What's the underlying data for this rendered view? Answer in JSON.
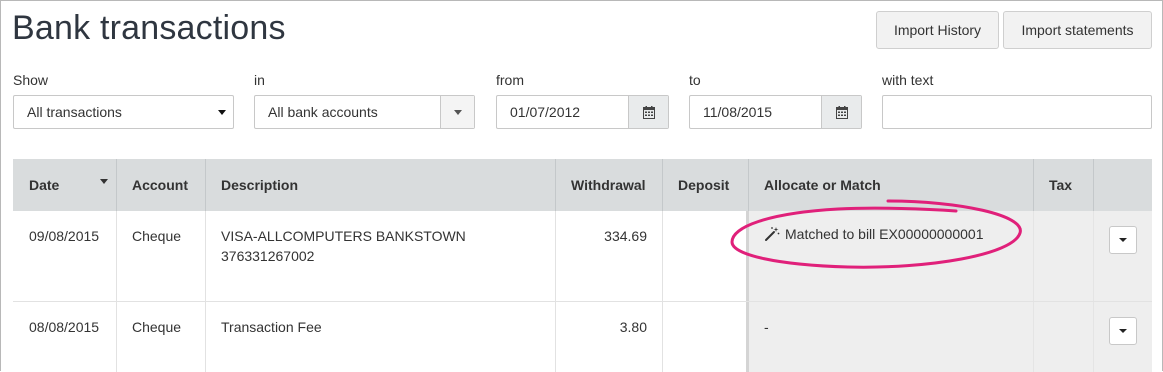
{
  "header": {
    "title": "Bank transactions",
    "import_history": "Import History",
    "import_statements": "Import statements"
  },
  "filters": {
    "show_label": "Show",
    "show_value": "All transactions",
    "in_label": "in",
    "in_value": "All bank accounts",
    "from_label": "from",
    "from_value": "01/07/2012",
    "to_label": "to",
    "to_value": "11/08/2015",
    "text_label": "with text",
    "text_value": ""
  },
  "table": {
    "columns": [
      "Date",
      "Account",
      "Description",
      "Withdrawal",
      "Deposit",
      "Allocate or Match",
      "Tax"
    ],
    "rows": [
      {
        "date": "09/08/2015",
        "account": "Cheque",
        "description_line1": "VISA-ALLCOMPUTERS BANKSTOWN",
        "description_line2": "376331267002",
        "withdrawal": "334.69",
        "deposit": "",
        "allocate": "Matched to bill EX00000000001",
        "tax": ""
      },
      {
        "date": "08/08/2015",
        "account": "Cheque",
        "description_line1": "Transaction Fee",
        "description_line2": "",
        "withdrawal": "3.80",
        "deposit": "",
        "allocate": "-",
        "tax": ""
      }
    ]
  },
  "colors": {
    "highlight": "#e0207a",
    "header_bg": "#d9dcdd",
    "allocate_bg": "#eeeeee"
  },
  "icons": {
    "calendar": "calendar-icon",
    "magic": "magic-wand-icon",
    "dropdown": "chevron-down-icon"
  }
}
